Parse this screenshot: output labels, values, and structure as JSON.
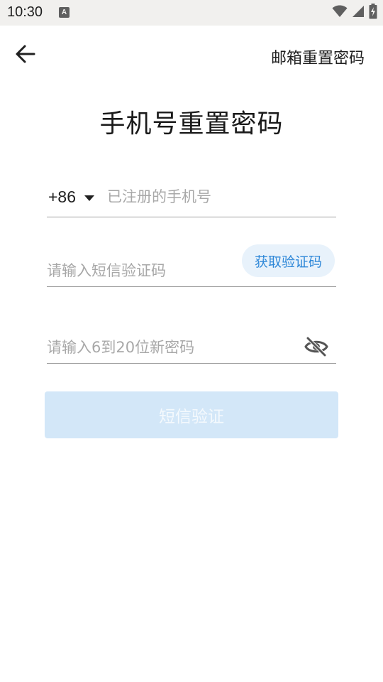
{
  "status_bar": {
    "time": "10:30",
    "notification_icon": "a-icon",
    "icons": [
      "wifi-icon",
      "cellular-signal-icon",
      "battery-charging-icon"
    ]
  },
  "app_bar": {
    "back_icon": "arrow-back-icon",
    "email_reset_label": "邮箱重置密码"
  },
  "title": "手机号重置密码",
  "form": {
    "phone": {
      "country_code": "+86",
      "placeholder": "已注册的手机号",
      "value": ""
    },
    "code": {
      "placeholder": "请输入短信验证码",
      "value": "",
      "get_code_label": "获取验证码"
    },
    "password": {
      "placeholder": "请输入6到20位新密码",
      "value": "",
      "visibility_icon": "eye-off-icon"
    },
    "submit_label": "短信验证"
  },
  "colors": {
    "accent": "#2f88d8",
    "accent_light_bg": "#e8f2fb",
    "submit_disabled_bg": "#d3e7f8",
    "underline": "#9e9e9e",
    "placeholder": "#a8a8a8"
  }
}
